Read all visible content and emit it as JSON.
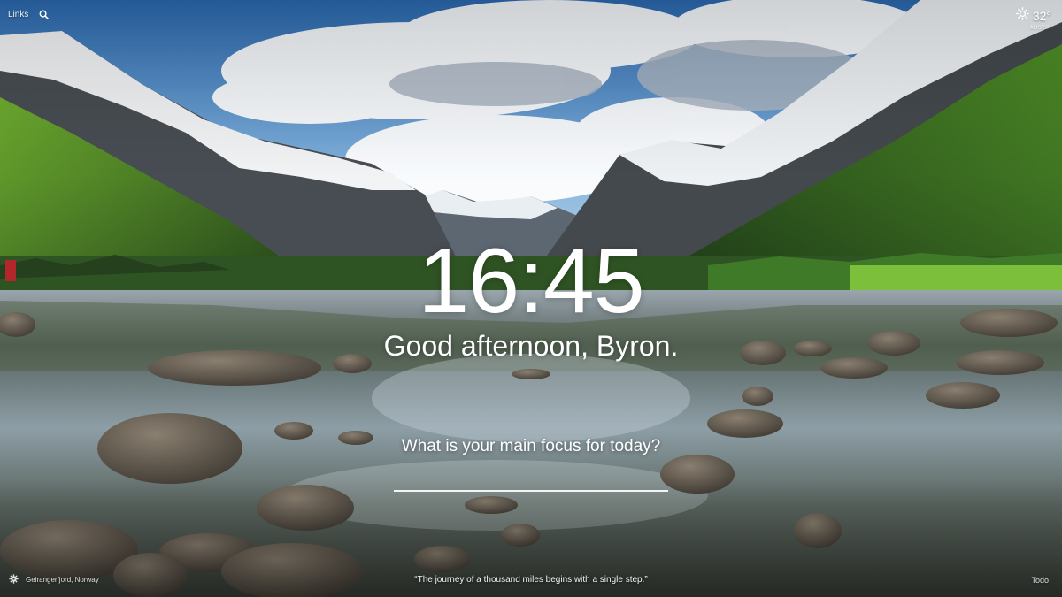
{
  "top_left": {
    "links_label": "Links",
    "search_icon": "search-icon"
  },
  "weather": {
    "icon": "sun-icon",
    "temperature": "32°",
    "location": "AUSTIN"
  },
  "main": {
    "clock": "16:45",
    "greeting": "Good afternoon, Byron.",
    "focus_question": "What is your main focus for today?",
    "focus_value": ""
  },
  "bottom": {
    "settings_icon": "gear-icon",
    "photo_location": "Geirangerfjord, Norway",
    "quote": "“The journey of a thousand miles begins with a single step.”",
    "todo_label": "Todo"
  },
  "colors": {
    "sky_top": "#2f6fb5",
    "sky_light": "#8fbde3",
    "snow": "#f3f5f7",
    "rock": "#4a4f55",
    "forest": "#2f5a22",
    "grass": "#7bbf3a",
    "water": "#3c4a4d"
  }
}
